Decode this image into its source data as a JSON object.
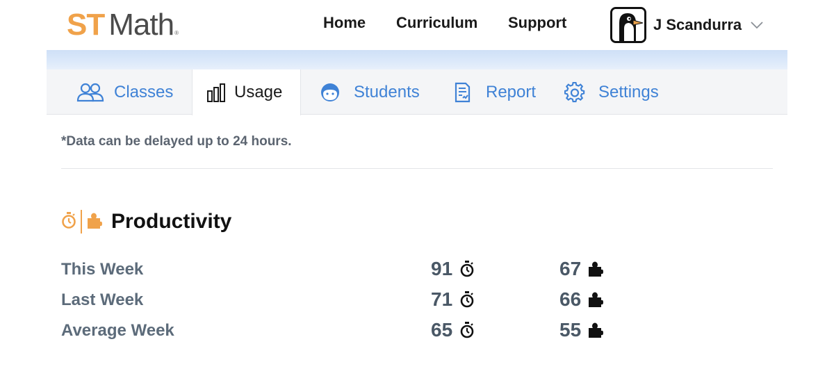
{
  "header": {
    "logo": {
      "part1": "ST",
      "part2": "Math",
      "reg": "®"
    },
    "nav": {
      "home": "Home",
      "curriculum": "Curriculum",
      "support": "Support"
    },
    "user": {
      "name": "J Scandurra",
      "avatar_icon": "penguin-avatar-icon",
      "menu_icon": "chevron-down-icon"
    }
  },
  "tabs": [
    {
      "label": "Classes",
      "icon": "people-icon",
      "active": false
    },
    {
      "label": "Usage",
      "icon": "bar-chart-icon",
      "active": true
    },
    {
      "label": "Students",
      "icon": "student-face-icon",
      "active": false
    },
    {
      "label": "Report",
      "icon": "report-icon",
      "active": false
    },
    {
      "label": "Settings",
      "icon": "gear-icon",
      "active": false
    }
  ],
  "notice": "*Data can be delayed up to 24 hours.",
  "productivity": {
    "title": "Productivity",
    "header_icons": [
      "stopwatch-icon",
      "puzzle-piece-icon"
    ],
    "rows": [
      {
        "label": "This Week",
        "minutes": "91",
        "puzzles": "67"
      },
      {
        "label": "Last Week",
        "minutes": "71",
        "puzzles": "66"
      },
      {
        "label": "Average Week",
        "minutes": "65",
        "puzzles": "55"
      }
    ]
  },
  "colors": {
    "brand_orange": "#f0a24a",
    "link_blue": "#3f82d6",
    "label_gray": "#5c6b7a"
  }
}
